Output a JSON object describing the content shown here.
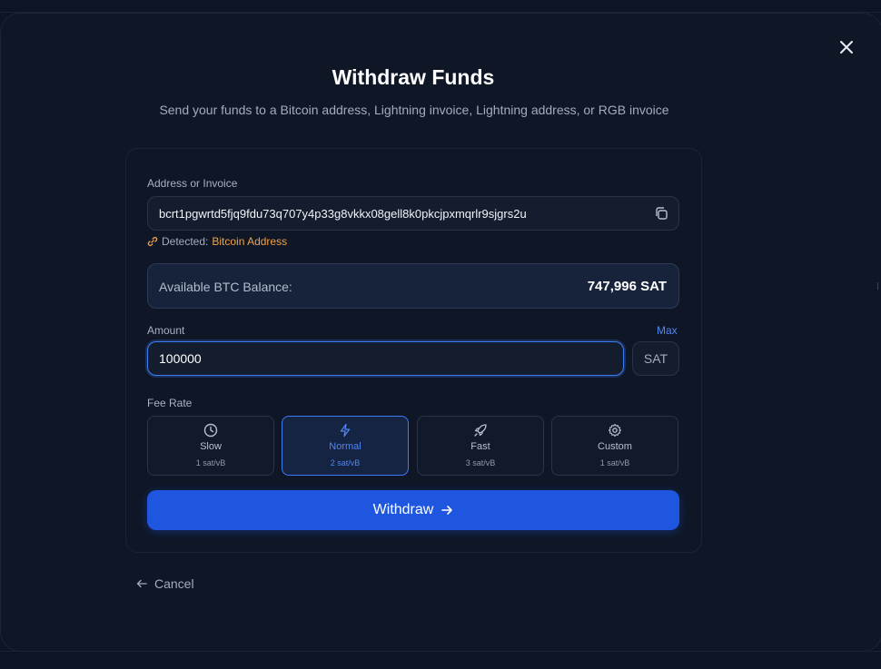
{
  "dialog": {
    "title": "Withdraw Funds",
    "subtitle": "Send your funds to a Bitcoin address, Lightning invoice, Lightning address, or RGB invoice"
  },
  "address": {
    "label": "Address or Invoice",
    "value": "bcrt1pgwrtd5fjq9fdu73q707y4p33g8vkkx08gell8k0pkcjpxmqrlr9sjgrs2u",
    "detected_prefix": "Detected:",
    "detected_type": "Bitcoin Address"
  },
  "balance": {
    "label": "Available BTC Balance:",
    "value": "747,996 SAT"
  },
  "amount": {
    "label": "Amount",
    "max_label": "Max",
    "value": "100000",
    "unit": "SAT"
  },
  "fee": {
    "label": "Fee Rate",
    "options": [
      {
        "name": "Slow",
        "rate": "1 sat/vB",
        "icon": "clock-icon",
        "selected": false
      },
      {
        "name": "Normal",
        "rate": "2 sat/vB",
        "icon": "lightning-icon",
        "selected": true
      },
      {
        "name": "Fast",
        "rate": "3 sat/vB",
        "icon": "rocket-icon",
        "selected": false
      },
      {
        "name": "Custom",
        "rate": "1 sat/vB",
        "icon": "gear-icon",
        "selected": false
      }
    ]
  },
  "actions": {
    "withdraw_label": "Withdraw",
    "cancel_label": "Cancel"
  },
  "colors": {
    "accent": "#1f56e0",
    "detected": "#f0a24a",
    "link": "#4f86f0"
  }
}
